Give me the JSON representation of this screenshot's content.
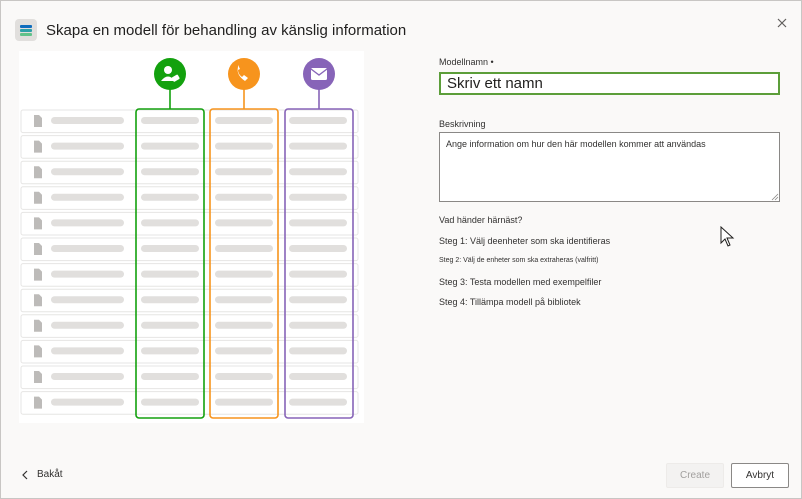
{
  "dialog": {
    "title": "Skapa en modell för behandling av känslig information"
  },
  "illustration": {
    "column_colors": {
      "green": "#13a10e",
      "orange": "#f7941d",
      "purple": "#8764b8"
    },
    "column_icons": [
      "person-tag-icon",
      "phone-icon",
      "mail-icon"
    ]
  },
  "form": {
    "name_label": "Modellnamn •",
    "name_placeholder": "Skriv ett namn",
    "description_label": "Beskrivning",
    "description_placeholder": "Ange information om hur den här modellen kommer att användas"
  },
  "next_steps": {
    "heading": "Vad händer härnäst?",
    "steps": [
      "Steg 1: Välj deenheter som ska identifieras",
      "Steg 2: Välj de enheter som ska extraheras (valfritt)",
      "Steg 3: Testa modellen med exempelfiler",
      "Steg 4: Tillämpa modell på bibliotek"
    ]
  },
  "footer": {
    "back_label": "Bakåt",
    "create_label": "Create",
    "cancel_label": "Avbryt"
  }
}
